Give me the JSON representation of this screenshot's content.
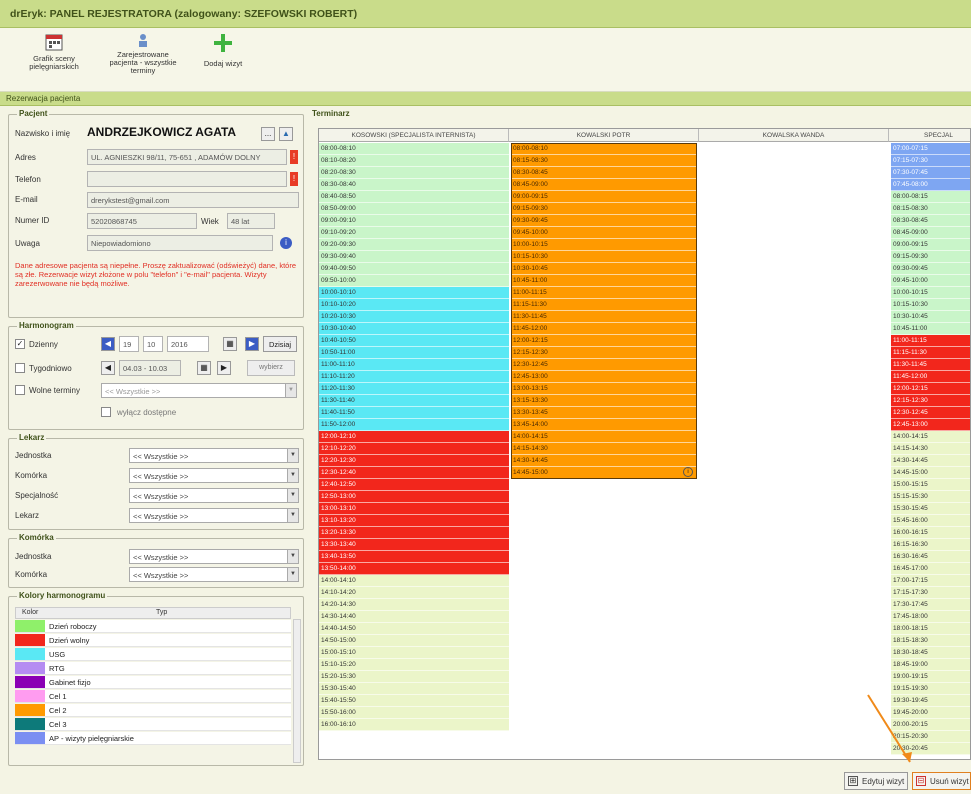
{
  "window": {
    "title": "drEryk: PANEL REJESTRATORA (zalogowany: SZEFOWSKI ROBERT)"
  },
  "toolbar": {
    "schedule_label_1": "Grafik sceny",
    "schedule_label_2": "pielęgniarskich",
    "print_label_1": "Zarejestrowane",
    "print_label_2": "pacjenta - wszystkie",
    "print_label_3": "terminy",
    "add_label": "Dodaj wizyt"
  },
  "section": {
    "title": "Rezerwacja pacjenta"
  },
  "patient": {
    "group_title": "Pacjent",
    "name_label": "Nazwisko i imię",
    "name_value": "ANDRZEJKOWICZ AGATA",
    "address_label": "Adres",
    "address_value": "UL. AGNIESZKI 98/11, 75-651 , ADAMÓW DOLNY",
    "phone_label": "Telefon",
    "phone_value": "",
    "email_label": "E-mail",
    "email_value": "drerykstest@gmail.com",
    "pesel_label": "Numer ID",
    "pesel_value": "52020868745",
    "age_label": "Wiek",
    "age_value": "48 lat",
    "notes_label": "Uwaga",
    "notes_value": "Niepowiadomiono",
    "warning": "Dane adresowe pacjenta są niepełne. Proszę zaktualizować (odświeżyć) dane, które są złe. Rezerwacje wizyt złożone w polu \"telefon\" i \"e-mail\" pacjenta. Wizyty zarezerwowane nie będą możliwe.",
    "dots_button": "...",
    "edit_button": "▲"
  },
  "schedule": {
    "group_title": "Harmonogram",
    "single_label": "Dzienny",
    "day": "19",
    "month": "10",
    "year": "2016",
    "today_label": "Dzisiaj",
    "weekly_label": "Tygodniowo",
    "range_value": "04.03 - 10.03",
    "show_label": "wybierz",
    "free_label": "Wolne terminy",
    "free_value": "<< Wszystkie >>",
    "hide_label": "wyłącz dostępne"
  },
  "doctor": {
    "group_title": "Lekarz",
    "unit_label": "Jednostka",
    "unit_value": "<< Wszystkie >>",
    "cell_label": "Komórka",
    "cell_value": "<< Wszystkie >>",
    "specialty_label": "Specjalność",
    "specialty_value": "<< Wszystkie >>",
    "doctor_label": "Lekarz",
    "doctor_value": "<< Wszystkie >>"
  },
  "cell": {
    "group_title": "Komórka",
    "unit_label": "Jednostka",
    "unit_value": "<< Wszystkie >>",
    "cell_label": "Komórka",
    "cell_value": "<< Wszystkie >>"
  },
  "legend": {
    "group_title": "Kolory harmonogramu",
    "col_color": "Kolor",
    "col_type": "Typ",
    "items": [
      {
        "name": "Dzień roboczy",
        "color": "#8ff06a"
      },
      {
        "name": "Dzień wolny",
        "color": "#f2261c"
      },
      {
        "name": "USG",
        "color": "#5ae8f4"
      },
      {
        "name": "RTG",
        "color": "#b58cf2"
      },
      {
        "name": "Gabinet fizjo",
        "color": "#8a00b4"
      },
      {
        "name": "Cel 1",
        "color": "#ff9cf0"
      },
      {
        "name": "Cel 2",
        "color": "#ff9a00"
      },
      {
        "name": "Cel 3",
        "color": "#0d7a7a"
      },
      {
        "name": "AP - wizyty pielęgniarskie",
        "color": "#7b8ff2"
      }
    ]
  },
  "terms": {
    "title": "Terminarz",
    "columns": [
      "KOSOWSKI (SPECJALISTA INTERNISTA)",
      "KOWALSKI POTR",
      "KOWALSKA WANDA",
      "SPECJAL"
    ],
    "col_a": [
      "08:00-08:10",
      "08:10-08:20",
      "08:20-08:30",
      "08:30-08:40",
      "08:40-08:50",
      "08:50-09:00",
      "09:00-09:10",
      "09:10-09:20",
      "09:20-09:30",
      "09:30-09:40",
      "09:40-09:50",
      "09:50-10:00",
      "10:00-10:10",
      "10:10-10:20",
      "10:20-10:30",
      "10:30-10:40",
      "10:40-10:50",
      "10:50-11:00",
      "11:00-11:10",
      "11:10-11:20",
      "11:20-11:30",
      "11:30-11:40",
      "11:40-11:50",
      "11:50-12:00",
      "12:00-12:10",
      "12:10-12:20",
      "12:20-12:30",
      "12:30-12:40",
      "12:40-12:50",
      "12:50-13:00",
      "13:00-13:10",
      "13:10-13:20",
      "13:20-13:30",
      "13:30-13:40",
      "13:40-13:50",
      "13:50-14:00",
      "14:00-14:10",
      "14:10-14:20",
      "14:20-14:30",
      "14:30-14:40",
      "14:40-14:50",
      "14:50-15:00",
      "15:00-15:10",
      "15:10-15:20",
      "15:20-15:30",
      "15:30-15:40",
      "15:40-15:50",
      "15:50-16:00",
      "16:00-16:10"
    ],
    "col_b": [
      "08:00-08:10",
      "08:15-08:30",
      "08:30-08:45",
      "08:45-09:00",
      "09:00-09:15",
      "09:15-09:30",
      "09:30-09:45",
      "09:45-10:00",
      "10:00-10:15",
      "10:15-10:30",
      "10:30-10:45",
      "10:45-11:00",
      "11:00-11:15",
      "11:15-11:30",
      "11:30-11:45",
      "11:45-12:00",
      "12:00-12:15",
      "12:15-12:30",
      "12:30-12:45",
      "12:45-13:00",
      "13:00-13:15",
      "13:15-13:30",
      "13:30-13:45",
      "13:45-14:00",
      "14:00-14:15",
      "14:15-14:30",
      "14:30-14:45",
      "14:45-15:00"
    ],
    "col_d": [
      "07:00-07:15",
      "07:15-07:30",
      "07:30-07:45",
      "07:45-08:00",
      "08:00-08:15",
      "08:15-08:30",
      "08:30-08:45",
      "08:45-09:00",
      "09:00-09:15",
      "09:15-09:30",
      "09:30-09:45",
      "09:45-10:00",
      "10:00-10:15",
      "10:15-10:30",
      "10:30-10:45",
      "10:45-11:00",
      "11:00-11:15",
      "11:15-11:30",
      "11:30-11:45",
      "11:45-12:00",
      "12:00-12:15",
      "12:15-12:30",
      "12:30-12:45",
      "12:45-13:00",
      "14:00-14:15",
      "14:15-14:30",
      "14:30-14:45",
      "14:45-15:00",
      "15:00-15:15",
      "15:15-15:30",
      "15:30-15:45",
      "15:45-16:00",
      "16:00-16:15",
      "16:15-16:30",
      "16:30-16:45",
      "16:45-17:00",
      "17:00-17:15",
      "17:15-17:30",
      "17:30-17:45",
      "17:45-18:00",
      "18:00-18:15",
      "18:15-18:30",
      "18:30-18:45",
      "18:45-19:00",
      "19:00-19:15",
      "19:15-19:30",
      "19:30-19:45",
      "19:45-20:00",
      "20:00-20:15",
      "20:15-20:30",
      "20:30-20:45"
    ],
    "colors": {
      "green": "#c9f5c9",
      "cyan": "#5ae8f4",
      "red": "#f2261c",
      "yellow": "#ebf5c9",
      "orange": "#ff9a00",
      "blue": "#7ea6f2"
    }
  },
  "bottom": {
    "edit_label": "Edytuj wizyt",
    "delete_label": "Usuń wizyt"
  }
}
